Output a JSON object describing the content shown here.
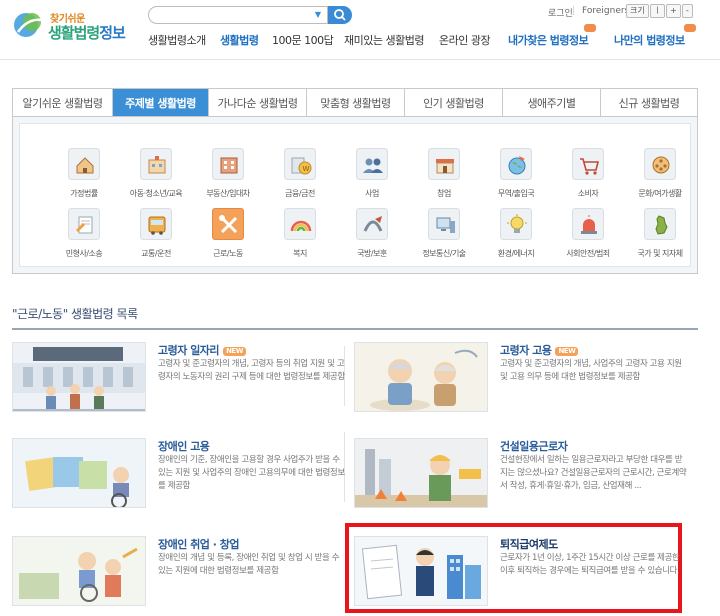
{
  "header": {
    "logo_small": "찾기쉬운",
    "logo_big_part1": "생활법령",
    "logo_big_part2": "정보",
    "search": {
      "value": "",
      "placeholder": ""
    },
    "login": "로그인",
    "foreigners": "Foreigners",
    "fontsize": {
      "label": "크기",
      "reset": "ㅣ",
      "plus": "+",
      "minus": "-"
    },
    "gnb": [
      {
        "label": "생활법령소개"
      },
      {
        "label": "생활법령"
      },
      {
        "label": "100문 100답"
      },
      {
        "label": "재미있는 생활법령"
      },
      {
        "label": "온라인 광장"
      },
      {
        "label": "내가찾은 법령정보"
      },
      {
        "label": "나만의 법령정보"
      }
    ]
  },
  "tabs": [
    {
      "label": "알기쉬운 생활법령"
    },
    {
      "label": "주제별 생활법령"
    },
    {
      "label": "가나다순 생활법령"
    },
    {
      "label": "맞춤형 생활법령"
    },
    {
      "label": "인기 생활법령"
    },
    {
      "label": "생애주기별"
    },
    {
      "label": "신규 생활법령"
    }
  ],
  "categories": [
    {
      "label": "가정법률",
      "icon": "house-icon"
    },
    {
      "label": "아동·청소년/교육",
      "icon": "school-icon"
    },
    {
      "label": "부동산/임대차",
      "icon": "building-icon"
    },
    {
      "label": "금융/금전",
      "icon": "coin-icon"
    },
    {
      "label": "사업",
      "icon": "people-icon"
    },
    {
      "label": "창업",
      "icon": "store-icon"
    },
    {
      "label": "무역/출입국",
      "icon": "globe-icon"
    },
    {
      "label": "소비자",
      "icon": "cart-icon"
    },
    {
      "label": "문화/여가생활",
      "icon": "film-icon"
    },
    {
      "label": "민형사/소송",
      "icon": "document-pen-icon"
    },
    {
      "label": "교통/운전",
      "icon": "bus-icon"
    },
    {
      "label": "근로/노동",
      "icon": "tools-icon"
    },
    {
      "label": "복지",
      "icon": "rainbow-icon"
    },
    {
      "label": "국방/보훈",
      "icon": "medal-icon"
    },
    {
      "label": "정보통신/기술",
      "icon": "computer-icon"
    },
    {
      "label": "환경/에너지",
      "icon": "bulb-icon"
    },
    {
      "label": "사회안전/범죄",
      "icon": "siren-icon"
    },
    {
      "label": "국가 및 지자체",
      "icon": "korea-map-icon"
    }
  ],
  "list": {
    "title": "\"근로/노동\" 생활법령 목록",
    "cards": [
      {
        "title": "고령자 일자리",
        "new": "NEW",
        "desc": "고령자 및 준고령자의 개념, 고령자 등의 취업 지원 및 고령자의 노동자의 권리 구제 등에 대한 법령정보를 제공함"
      },
      {
        "title": "고령자 고용",
        "new": "NEW",
        "desc": "고령자 및 준고령자의 개념, 사업주의 고령자 고용 지원 및 고용 의무 등에 대한 법령정보를 제공함"
      },
      {
        "title": "장애인 고용",
        "new": "",
        "desc": "장애인의 기준, 장애인을 고용할 경우 사업주가 받을 수 있는 지원 및 사업주의 장애인 고용의무에 대한 법령정보를 제공함"
      },
      {
        "title": "건설일용근로자",
        "new": "",
        "desc": "건설현장에서 일하는 일용근로자라고 부당한 대우를 받지는 않으셨나요? 건설일용근로자의 근로시간, 근로계약서 작성, 휴게·휴일·휴가, 임금, 산업재해 ..."
      },
      {
        "title": "장애인 취업 · 창업",
        "new": "",
        "desc": "장애인의 개념 및 등록, 장애인 취업 및 창업 시 받을 수 있는 지원에 대한 법령정보를 제공함"
      },
      {
        "title": "퇴직급여제도",
        "new": "",
        "desc": "근로자가 1년 이상, 1주간 15시간 이상 근로를 제공한 이후 퇴직하는 경우에는 퇴직급여를 받을 수 있습니다."
      }
    ]
  },
  "colors": {
    "tab_active": "#3a8fd6",
    "accent_orange": "#f4a15a",
    "highlight_red": "#e8151b",
    "title_blue": "#2a5c9a"
  }
}
